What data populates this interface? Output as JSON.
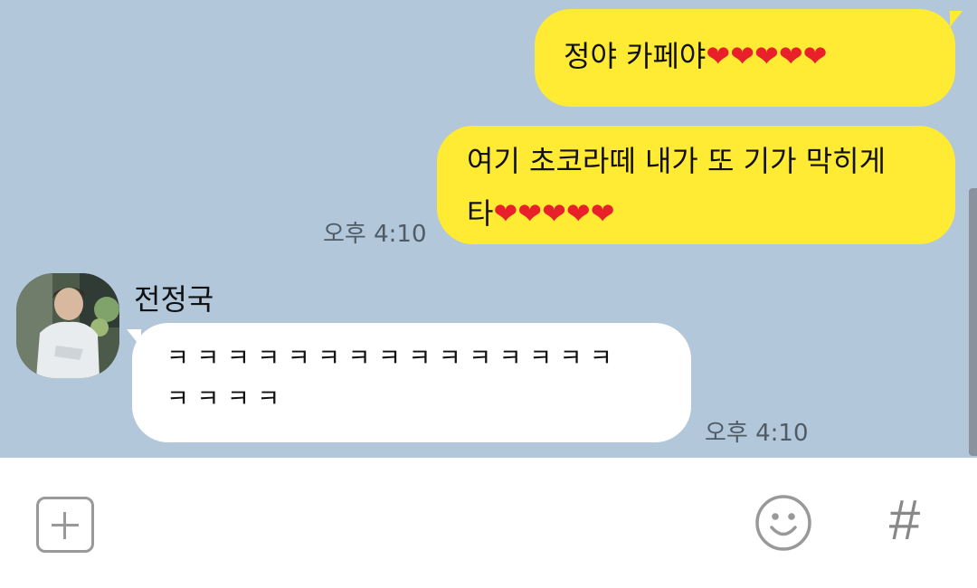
{
  "messages": {
    "sent_1": {
      "text": "정야 카페야",
      "hearts": "❤❤❤❤❤"
    },
    "sent_2": {
      "line1": "여기 초코라떼 내가 또 기가 막히게",
      "line2_text": "타",
      "hearts": "❤❤❤❤❤",
      "time": "오후 4:10"
    },
    "received_1": {
      "sender": "전정국",
      "line1": "ㅋ ㅋ ㅋ ㅋ ㅋ ㅋ ㅋ ㅋ ㅋ ㅋ ㅋ ㅋ ㅋ ㅋ ㅋ",
      "line2": "ㅋ ㅋ ㅋ ㅋ",
      "time": "오후 4:10"
    }
  },
  "input_bar": {
    "plus_icon": "plus-square-icon",
    "emoji_icon": "smiley-icon",
    "hash_label": "#"
  },
  "colors": {
    "chat_background": "#b2c7d9",
    "sent_bubble": "#ffeb33",
    "received_bubble": "#ffffff",
    "heart": "#e8202a"
  }
}
